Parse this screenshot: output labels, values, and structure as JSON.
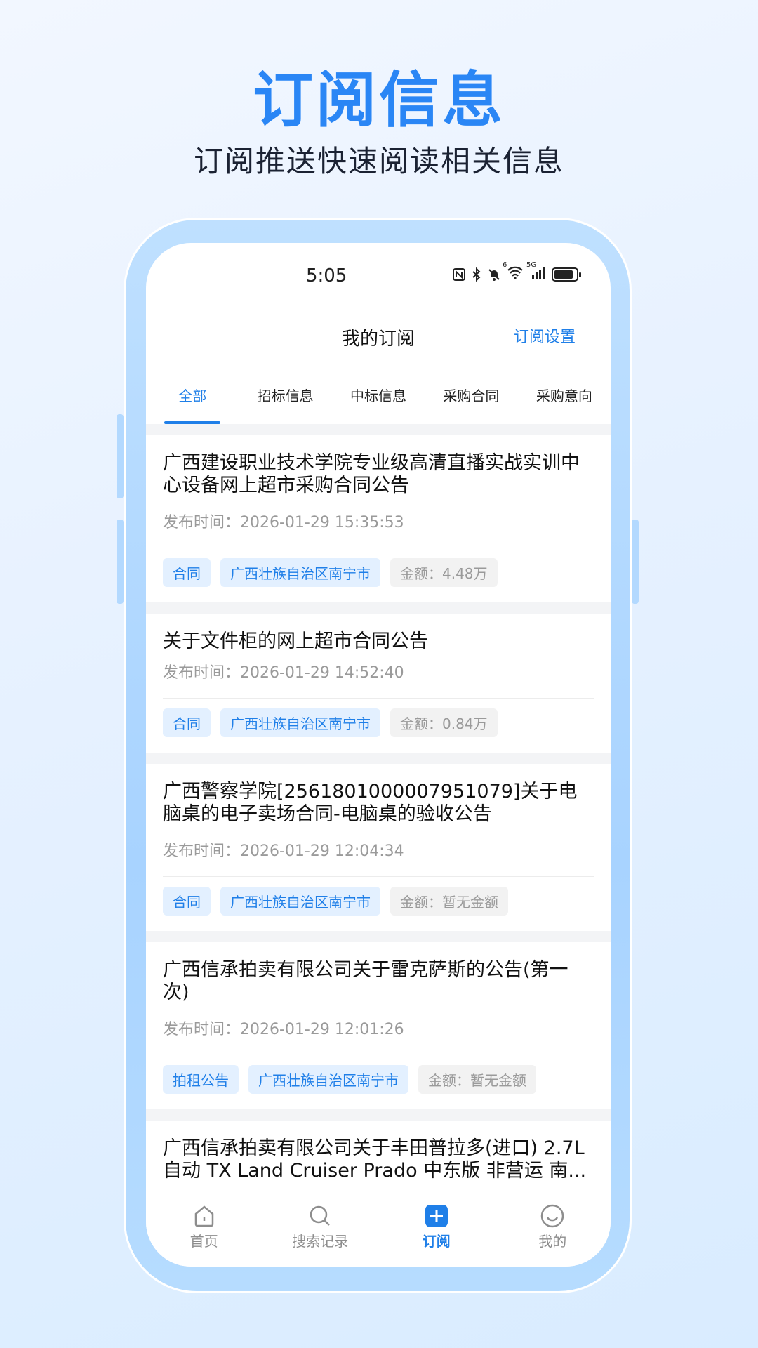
{
  "promo": {
    "title": "订阅信息",
    "subtitle": "订阅推送快速阅读相关信息"
  },
  "status_bar": {
    "time": "5:05",
    "icons": [
      "nfc-icon",
      "bluetooth-icon",
      "mute-icon",
      "wifi-icon",
      "5g-icon",
      "signal-icon",
      "battery-icon"
    ],
    "wifi_label": "6",
    "net_label": "5G"
  },
  "header": {
    "title": "我的订阅",
    "action": "订阅设置"
  },
  "tabs": [
    {
      "label": "全部",
      "active": true
    },
    {
      "label": "招标信息",
      "active": false
    },
    {
      "label": "中标信息",
      "active": false
    },
    {
      "label": "采购合同",
      "active": false
    },
    {
      "label": "采购意向",
      "active": false
    }
  ],
  "list": [
    {
      "title": "广西建设职业技术学院专业级高清直播实战实训中心设备网上超市采购合同公告",
      "time": "发布时间：2026-01-29 15:35:53",
      "tags": [
        "合同",
        "广西壮族自治区南宁市"
      ],
      "amount": "金额：4.48万"
    },
    {
      "title": "关于文件柜的网上超市合同公告",
      "time": "发布时间：2026-01-29 14:52:40",
      "tags": [
        "合同",
        "广西壮族自治区南宁市"
      ],
      "amount": "金额：0.84万"
    },
    {
      "title": "广西警察学院[2561801000007951079]关于电脑桌的电子卖场合同-电脑桌的验收公告",
      "time": "发布时间：2026-01-29 12:04:34",
      "tags": [
        "合同",
        "广西壮族自治区南宁市"
      ],
      "amount": "金额：暂无金额"
    },
    {
      "title": "广西信承拍卖有限公司关于雷克萨斯的公告(第一次)",
      "time": "发布时间：2026-01-29 12:01:26",
      "tags": [
        "拍租公告",
        "广西壮族自治区南宁市"
      ],
      "amount": "金额：暂无金额"
    },
    {
      "title_line1": "广西信承拍卖有限公司关于丰田普拉多(进口) 2.7L",
      "title_line2": "自动 TX Land Cruiser Prado 中东版 非营运 南..."
    }
  ],
  "tabbar": [
    {
      "label": "首页",
      "icon": "home-icon",
      "active": false
    },
    {
      "label": "搜索记录",
      "icon": "search-icon",
      "active": false
    },
    {
      "label": "订阅",
      "icon": "plus-icon",
      "active": true
    },
    {
      "label": "我的",
      "icon": "profile-icon",
      "active": false
    }
  ],
  "colors": {
    "accent": "#1f7fe8",
    "title_blue": "#2a86f5",
    "tag_bg": "#e3f0ff",
    "muted": "#9a9a9a"
  }
}
